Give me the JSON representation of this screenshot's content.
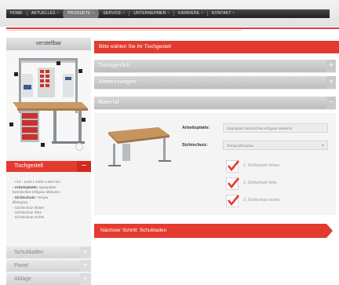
{
  "nav": {
    "items": [
      {
        "label": "HOME",
        "active": false
      },
      {
        "label": "AKTUELLES  ~",
        "active": false
      },
      {
        "label": "PRODUKTE  ~",
        "active": true
      },
      {
        "label": "SERVICE  ~",
        "active": false
      },
      {
        "label": "UNTERNEHMEN  ~",
        "active": false
      },
      {
        "label": "KARRIERE  ~",
        "active": false
      },
      {
        "label": "KONTAKT  ~",
        "active": false
      }
    ]
  },
  "sidebar": {
    "header": "verstellbar",
    "selected": {
      "label": "Tischgestell",
      "toggle": "−"
    },
    "details": {
      "size": "- 713 - 1120 x 1200 x 800 mm",
      "arbeitsplatte_label": "- Arbeitsplatte:",
      "arbeitsplatte_value": "Spanplatte",
      "arbeitsplatte_value2": "beschichtet erhlgrau Melamin",
      "sichtschutz_label": "- Sichtschutz:",
      "sichtschutz_value": "Tempa",
      "sichtschutz_value2": "klbergrau",
      "items": [
        "- Sichtschutz hinten",
        "- Sichtschutz links",
        "- Sichtschutz rechts"
      ]
    },
    "accordions": [
      {
        "label": "Schubladen",
        "toggle": "+"
      },
      {
        "label": "Panel",
        "toggle": "+"
      },
      {
        "label": "Ablage",
        "toggle": "+"
      }
    ]
  },
  "main": {
    "header": "Bitte wählen Sie Ihr Tischgestell",
    "sections": [
      {
        "label": "Tischgestell",
        "toggle": "+"
      },
      {
        "label": "Abmessungen",
        "toggle": "+"
      },
      {
        "label": "Material",
        "toggle": "−"
      }
    ],
    "material": {
      "arbeitsplatte_label": "Arbeitsplatte:",
      "arbeitsplatte_value": "Spanplatte beschichtet erhlgrau Melamin",
      "sichtschutz_label": "Sichtschutz:",
      "sichtschutz_value": "Tempa klbergrau",
      "options": [
        {
          "label": "1. Sichtschutz hinten",
          "checked": true
        },
        {
          "label": "2. Sichtschutz links",
          "checked": true
        },
        {
          "label": "3. Sichtschutz rechts",
          "checked": true
        }
      ]
    },
    "next_button": "Nächster Schritt: Schubladen"
  },
  "colors": {
    "accent": "#e33b30",
    "nav_bg": "#2a2a2a"
  }
}
